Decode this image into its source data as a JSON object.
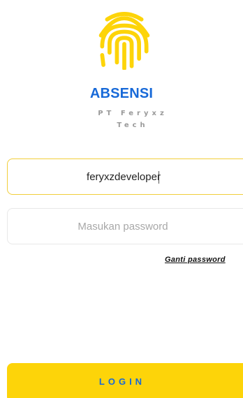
{
  "app": {
    "title": "ABSENSI",
    "company": "PT Feryxz Tech",
    "logo_icon": "fingerprint-icon",
    "accent_color": "#fdd409",
    "brand_color": "#1769d8"
  },
  "form": {
    "username_value": "feryxzdeveloper",
    "password_placeholder": "Masukan password",
    "change_password_label": "Ganti password",
    "login_label": "LOGIN"
  }
}
